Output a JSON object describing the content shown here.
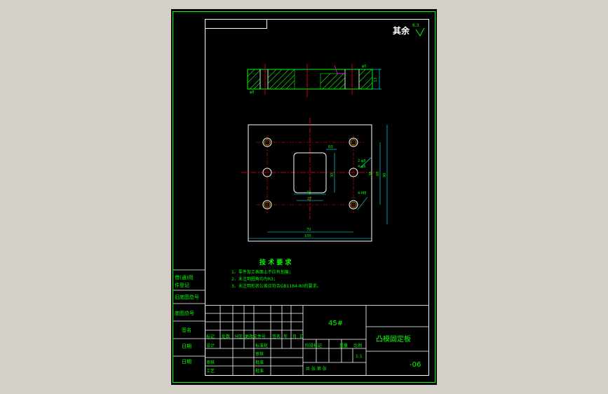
{
  "colors": {
    "background": "#d4d0c8",
    "sheet": "#000000",
    "frame": "#ffffff",
    "outline": "#00ff00",
    "centerline": "#ff0000",
    "dimension": "#00ffff",
    "hatch": "#00ff00",
    "section": "#ff00ff"
  },
  "drawing": {
    "surface_note": "其余",
    "roughness_value": "6.3",
    "section_labels": {
      "left": "φ8",
      "right_top": "φ5",
      "height_dim": "13"
    },
    "plan_dims": {
      "r_corner": "R3",
      "inner_w": "42",
      "inner_w2": "27",
      "inner_h": "30",
      "bottom_outer": "100",
      "bottom_holes": "70",
      "right_outer": "90",
      "right_holes": "60",
      "right_mid": "38",
      "thread_note": "2-φ8",
      "thread_note2": "4-M8",
      "hole_note": "4-φ6"
    },
    "tech_req": {
      "title": "技 术 要 求",
      "items": [
        "1、零件加工表面上不应有划痕；",
        "2、未注明圆角均为R3；",
        "3、未注明形状公差应符合GB1184-80的要求。"
      ]
    }
  },
  "left_strip": {
    "labels": [
      "借(通)用",
      "件登记",
      "旧底图总号",
      "底图总号",
      "签名",
      "日期",
      "日期"
    ]
  },
  "title_block": {
    "material": "45#",
    "part_name": "凸模固定板",
    "drawing_no": "-06",
    "header_cells": [
      "标记",
      "处数",
      "分区",
      "更改文件号",
      "签名",
      "年",
      "月",
      "日"
    ],
    "role_rows": [
      {
        "role": "设计",
        "mid": "标准化"
      },
      {
        "role": "",
        "mid": "审核"
      },
      {
        "role": "审核",
        "mid": "批准"
      },
      {
        "role": "工艺",
        "mid": "批准"
      }
    ],
    "stage_headers": [
      "阶段标记",
      "重量",
      "比例"
    ],
    "scale": "1:1",
    "sheets": "共    张  第    张"
  }
}
